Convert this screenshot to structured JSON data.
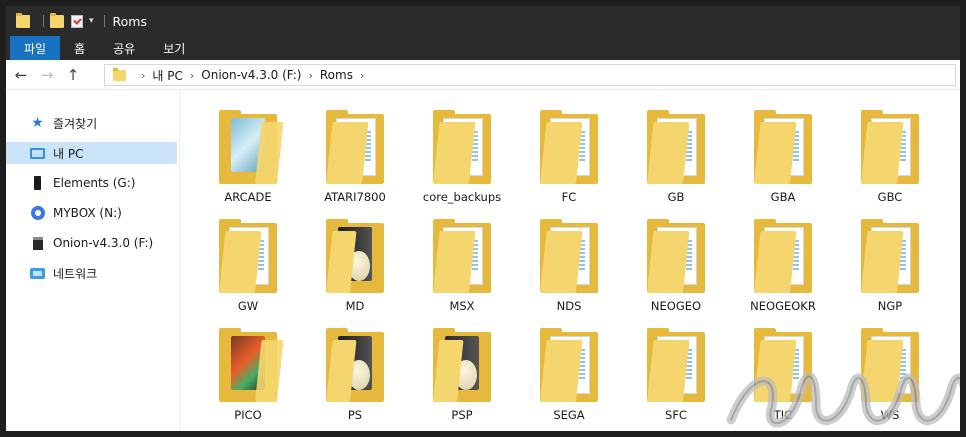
{
  "titlebar": {
    "title": "Roms"
  },
  "ribbon": {
    "tabs": [
      "파일",
      "홈",
      "공유",
      "보기"
    ]
  },
  "address": {
    "segments": [
      "내 PC",
      "Onion-v4.3.0 (F:)",
      "Roms"
    ]
  },
  "sidebar": {
    "items": [
      {
        "label": "즐겨찾기",
        "icon": "star-icon"
      },
      {
        "label": "내 PC",
        "icon": "pc-icon",
        "selected": true
      },
      {
        "label": "Elements (G:)",
        "icon": "drive-icon"
      },
      {
        "label": "MYBOX (N:)",
        "icon": "mybox-icon"
      },
      {
        "label": "Onion-v4.3.0 (F:)",
        "icon": "sd-card-icon"
      },
      {
        "label": "네트워크",
        "icon": "network-icon"
      }
    ]
  },
  "folders": [
    "ARCADE",
    "ATARI7800",
    "core_backups",
    "FC",
    "GB",
    "GBA",
    "GBC",
    "GW",
    "MD",
    "MSX",
    "NDS",
    "NEOGEO",
    "NEOGEOKR",
    "NGP",
    "PICO",
    "PS",
    "PSP",
    "SEGA",
    "SFC",
    "TIC",
    "WS"
  ],
  "colors": {
    "accent": "#1971c2",
    "titlebar": "#2b2b2b",
    "folder": "#f5d66e",
    "folder_back": "#e6b93c",
    "selection": "#cce4f7"
  }
}
